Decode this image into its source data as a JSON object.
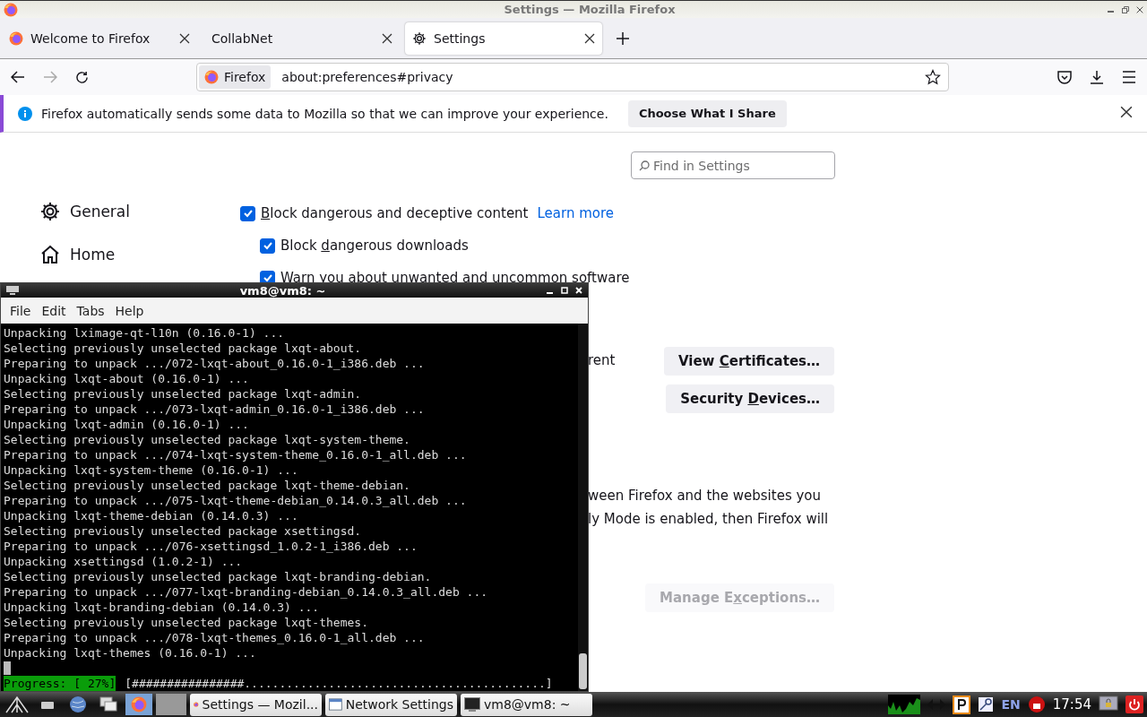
{
  "window": {
    "title": "Settings — Mozilla Firefox"
  },
  "tabs": [
    {
      "label": "Welcome to Firefox",
      "kind": "firefox",
      "selected": false
    },
    {
      "label": "CollabNet",
      "kind": "plain",
      "selected": false
    },
    {
      "label": "Settings",
      "kind": "settings",
      "selected": true
    }
  ],
  "url_bar": {
    "identity": "Firefox",
    "url": "about:preferences#privacy"
  },
  "notification": {
    "message": "Firefox automatically sends some data to Mozilla so that we can improve your experience.",
    "button": "Choose What I Share"
  },
  "search": {
    "placeholder": "Find in Settings"
  },
  "sidebar": {
    "items": [
      {
        "label": "General",
        "kind": "general"
      },
      {
        "label": "Home",
        "kind": "home"
      }
    ]
  },
  "checkboxes": [
    {
      "label_parts": [
        {
          "text": "B",
          "access_key": true
        },
        {
          "text": "lock dangerous and deceptive content",
          "access_key": false
        }
      ],
      "checked": true,
      "link": "Learn more",
      "children": [
        {
          "label_parts": [
            {
              "text": "Block ",
              "access_key": false
            },
            {
              "text": "d",
              "access_key": true
            },
            {
              "text": "angerous downloads",
              "access_key": false
            }
          ],
          "checked": true
        },
        {
          "label_parts": [
            {
              "text": "Warn you about unwanted and uncommon software",
              "access_key": false
            }
          ],
          "checked": true
        }
      ]
    }
  ],
  "certificates": {
    "fragment": "rent",
    "buttons": [
      {
        "label_parts": [
          {
            "text": "View ",
            "access_key": false
          },
          {
            "text": "C",
            "access_key": true
          },
          {
            "text": "ertificates…",
            "access_key": false
          }
        ],
        "disabled": false
      },
      {
        "label_parts": [
          {
            "text": "Security ",
            "access_key": false
          },
          {
            "text": "D",
            "access_key": true
          },
          {
            "text": "evices…",
            "access_key": false
          }
        ],
        "disabled": false
      }
    ]
  },
  "https_text": [
    "ween Firefox and the websites you",
    "ly Mode is enabled, then Firefox will"
  ],
  "exceptions_button": {
    "label_parts": [
      {
        "text": "Manage E",
        "access_key": false
      },
      {
        "text": "x",
        "access_key": true
      },
      {
        "text": "ceptions…",
        "access_key": false
      }
    ],
    "disabled": true
  },
  "terminal": {
    "title": "vm8@vm8: ~",
    "menu": [
      "File",
      "Edit",
      "Tabs",
      "Help"
    ],
    "lines": [
      "Unpacking lximage-qt-l10n (0.16.0-1) ...",
      "Selecting previously unselected package lxqt-about.",
      "Preparing to unpack .../072-lxqt-about_0.16.0-1_i386.deb ...",
      "Unpacking lxqt-about (0.16.0-1) ...",
      "Selecting previously unselected package lxqt-admin.",
      "Preparing to unpack .../073-lxqt-admin_0.16.0-1_i386.deb ...",
      "Unpacking lxqt-admin (0.16.0-1) ...",
      "Selecting previously unselected package lxqt-system-theme.",
      "Preparing to unpack .../074-lxqt-system-theme_0.16.0-1_all.deb ...",
      "Unpacking lxqt-system-theme (0.16.0-1) ...",
      "Selecting previously unselected package lxqt-theme-debian.",
      "Preparing to unpack .../075-lxqt-theme-debian_0.14.0.3_all.deb ...",
      "Unpacking lxqt-theme-debian (0.14.0.3) ...",
      "Selecting previously unselected package xsettingsd.",
      "Preparing to unpack .../076-xsettingsd_1.0.2-1_i386.deb ...",
      "Unpacking xsettingsd (1.0.2-1) ...",
      "Selecting previously unselected package lxqt-branding-debian.",
      "Preparing to unpack .../077-lxqt-branding-debian_0.14.0.3_all.deb ...",
      "Unpacking lxqt-branding-debian (0.14.0.3) ...",
      "Selecting previously unselected package lxqt-themes.",
      "Preparing to unpack .../078-lxqt-themes_0.16.0-1_all.deb ...",
      "Unpacking lxqt-themes (0.16.0-1) ..."
    ],
    "progress_label": "Progress: [ 27%]",
    "progress_bar": "[################...........................................]"
  },
  "taskbar": {
    "tasks": [
      {
        "label": "Settings — Mozil...",
        "kind": "browser"
      },
      {
        "label": "Network Settings",
        "kind": "dialog"
      },
      {
        "label": "vm8@vm8: ~",
        "kind": "terminal"
      }
    ],
    "language": "EN",
    "clock": "17:54"
  }
}
